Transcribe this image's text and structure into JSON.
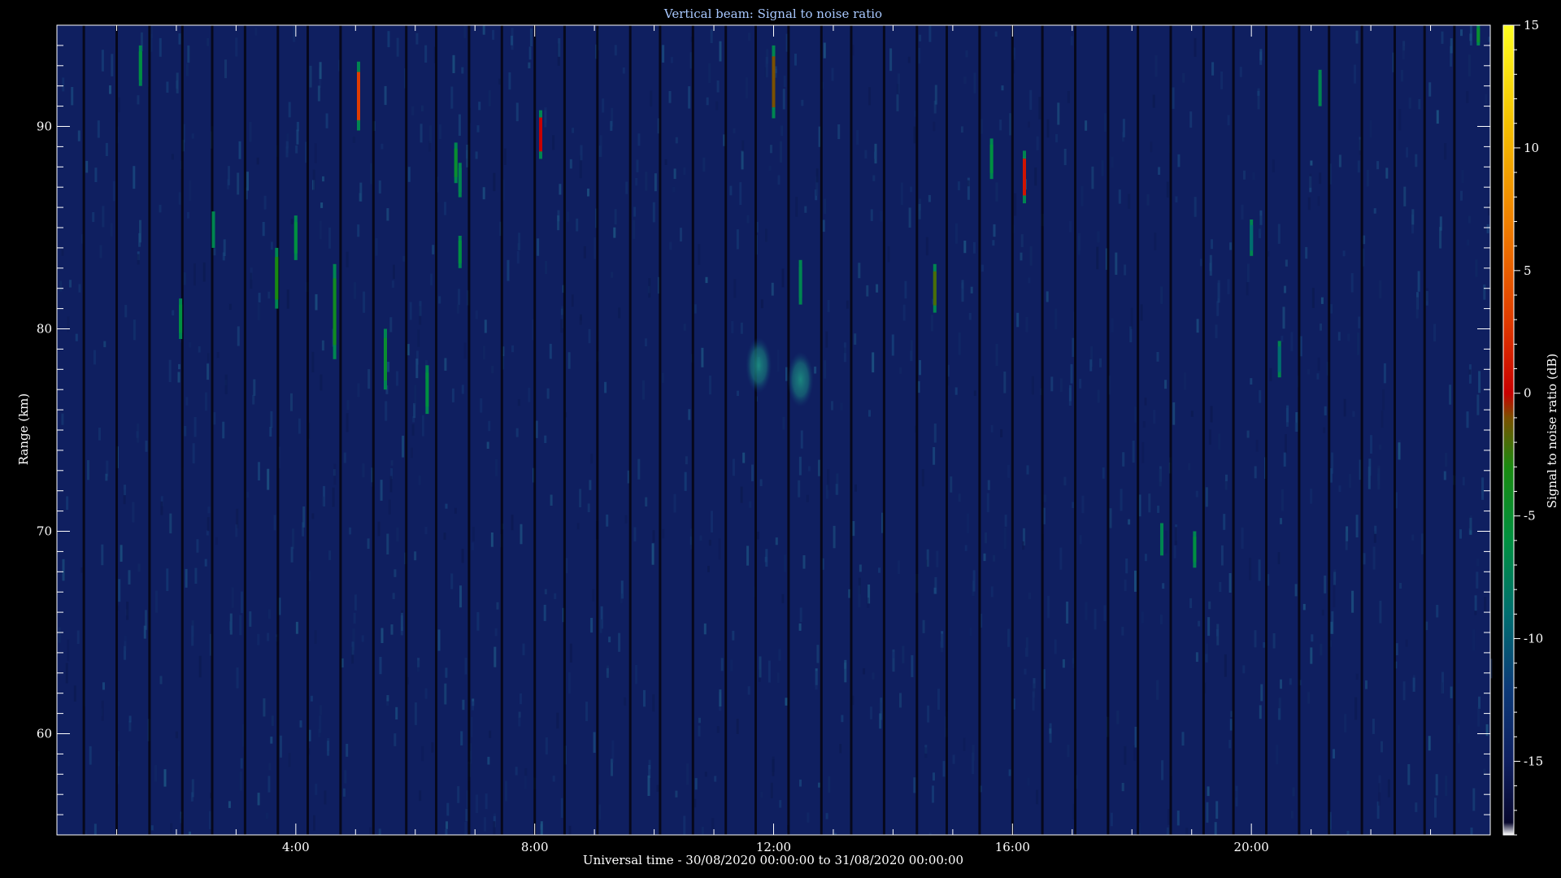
{
  "chart_data": {
    "type": "heatmap",
    "title": "Vertical beam: Signal to noise ratio",
    "xlabel": "Universal time - 30/08/2020 00:00:00 to 31/08/2020 00:00:00",
    "ylabel": "Range (km)",
    "x_unit": "hours UTC",
    "xlim": [
      0,
      24
    ],
    "ylim": [
      55,
      95
    ],
    "x_ticks": [
      {
        "value": 4,
        "label": "4:00"
      },
      {
        "value": 8,
        "label": "8:00"
      },
      {
        "value": 12,
        "label": "12:00"
      },
      {
        "value": 16,
        "label": "16:00"
      },
      {
        "value": 20,
        "label": "20:00"
      }
    ],
    "y_ticks": [
      {
        "value": 60,
        "label": "60"
      },
      {
        "value": 70,
        "label": "70"
      },
      {
        "value": 80,
        "label": "80"
      },
      {
        "value": 90,
        "label": "90"
      }
    ],
    "colorbar": {
      "label": "Signal to noise ratio (dB)",
      "range": [
        -18,
        15
      ],
      "ticks": [
        {
          "value": 15,
          "label": "15"
        },
        {
          "value": 10,
          "label": "10"
        },
        {
          "value": 5,
          "label": "5"
        },
        {
          "value": 0,
          "label": "0"
        },
        {
          "value": -5,
          "label": "-5"
        },
        {
          "value": -10,
          "label": "-10"
        },
        {
          "value": -15,
          "label": "-15"
        }
      ],
      "stops": [
        {
          "value": -18,
          "color": "#ffffff"
        },
        {
          "value": -17.5,
          "color": "#08082e"
        },
        {
          "value": -15,
          "color": "#0f1f60"
        },
        {
          "value": -12,
          "color": "#0c3a78"
        },
        {
          "value": -9,
          "color": "#006e70"
        },
        {
          "value": -6,
          "color": "#009040"
        },
        {
          "value": -3,
          "color": "#1a8a10"
        },
        {
          "value": -1,
          "color": "#7a5000"
        },
        {
          "value": 0,
          "color": "#c80000"
        },
        {
          "value": 3,
          "color": "#e03c00"
        },
        {
          "value": 7,
          "color": "#f08000"
        },
        {
          "value": 11,
          "color": "#f4c000"
        },
        {
          "value": 15,
          "color": "#ffff20"
        }
      ]
    },
    "background_snr_db": -15,
    "data_gap_times": [
      0.45,
      1.0,
      1.55,
      2.1,
      2.6,
      3.15,
      3.7,
      4.2,
      4.75,
      5.3,
      5.85,
      6.35,
      6.9,
      7.45,
      8.0,
      8.5,
      9.05,
      9.6,
      10.1,
      10.65,
      11.2,
      11.7,
      12.25,
      12.8,
      13.3,
      13.85,
      14.4,
      14.9,
      15.45,
      16.0,
      16.5,
      17.05,
      17.6,
      18.1,
      18.65,
      19.2,
      19.7,
      20.25,
      20.8,
      21.3,
      21.85,
      22.4,
      22.9,
      23.4
    ],
    "echoes": [
      {
        "t": 1.4,
        "range_top": 94,
        "range_bottom": 92,
        "snr_db": -6
      },
      {
        "t": 2.07,
        "range_top": 81.5,
        "range_bottom": 79.5,
        "snr_db": -6
      },
      {
        "t": 2.62,
        "range_top": 85.8,
        "range_bottom": 84,
        "snr_db": -7
      },
      {
        "t": 3.68,
        "range_top": 84,
        "range_bottom": 81,
        "snr_db": -3
      },
      {
        "t": 4.0,
        "range_top": 85.6,
        "range_bottom": 83.4,
        "snr_db": -6
      },
      {
        "t": 4.65,
        "range_top": 83.2,
        "range_bottom": 78.5,
        "snr_db": -4
      },
      {
        "t": 5.05,
        "range_top": 93.2,
        "range_bottom": 89.8,
        "snr_db": 3
      },
      {
        "t": 5.5,
        "range_top": 80,
        "range_bottom": 77,
        "snr_db": -5
      },
      {
        "t": 6.2,
        "range_top": 78.2,
        "range_bottom": 75.8,
        "snr_db": -6
      },
      {
        "t": 6.68,
        "range_top": 89.2,
        "range_bottom": 87.2,
        "snr_db": -5
      },
      {
        "t": 6.75,
        "range_top": 84.6,
        "range_bottom": 83,
        "snr_db": -6
      },
      {
        "t": 6.75,
        "range_top": 88.2,
        "range_bottom": 86.5,
        "snr_db": -7
      },
      {
        "t": 8.1,
        "range_top": 90.8,
        "range_bottom": 88.4,
        "snr_db": 0
      },
      {
        "t": 12.0,
        "range_top": 94,
        "range_bottom": 90.4,
        "snr_db": -1
      },
      {
        "t": 12.45,
        "range_top": 83.4,
        "range_bottom": 81.2,
        "snr_db": -7
      },
      {
        "t": 14.7,
        "range_top": 83.2,
        "range_bottom": 80.8,
        "snr_db": -2
      },
      {
        "t": 15.65,
        "range_top": 89.4,
        "range_bottom": 87.4,
        "snr_db": -6
      },
      {
        "t": 16.2,
        "range_top": 88.8,
        "range_bottom": 86.2,
        "snr_db": 1
      },
      {
        "t": 18.5,
        "range_top": 70.4,
        "range_bottom": 68.8,
        "snr_db": -7
      },
      {
        "t": 19.05,
        "range_top": 70,
        "range_bottom": 68.2,
        "snr_db": -6
      },
      {
        "t": 20.0,
        "range_top": 85.4,
        "range_bottom": 83.6,
        "snr_db": -9
      },
      {
        "t": 20.47,
        "range_top": 79.4,
        "range_bottom": 77.6,
        "snr_db": -9
      },
      {
        "t": 21.15,
        "range_top": 92.8,
        "range_bottom": 91,
        "snr_db": -7
      },
      {
        "t": 23.8,
        "range_top": 95,
        "range_bottom": 94,
        "snr_db": -5
      }
    ],
    "blobs": [
      {
        "t": 11.75,
        "range": 78.2,
        "snr_db": -9
      },
      {
        "t": 12.45,
        "range": 77.5,
        "snr_db": -10
      }
    ]
  }
}
